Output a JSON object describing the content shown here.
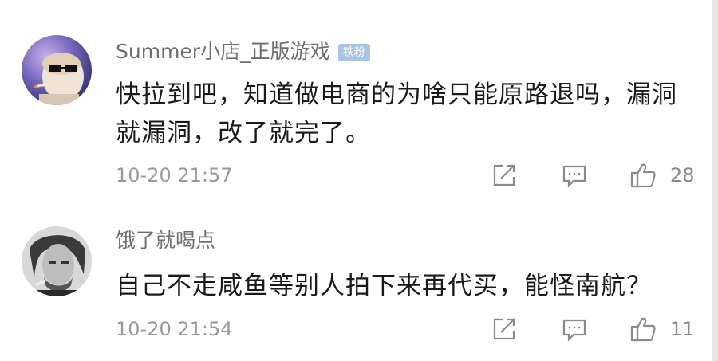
{
  "comments": [
    {
      "username": "Summer小店_正版游戏",
      "badge": "铁粉",
      "text": "快拉到吧，知道做电商的为啥只能原路退吗，漏洞就漏洞，改了就完了。",
      "time": "10-20 21:57",
      "likes": "28"
    },
    {
      "username": "饿了就喝点",
      "text": "自己不走咸鱼等别人拍下来再代买，能怪南航？",
      "time": "10-20 21:54",
      "likes": "11"
    }
  ],
  "icons": {
    "share": "share-icon",
    "reply": "comment-icon",
    "like": "thumbs-up-icon"
  },
  "colors": {
    "badge": "#a7c3e6",
    "username": "#6e6e6e",
    "text": "#1a1a1a",
    "meta": "#9a9a9a"
  }
}
